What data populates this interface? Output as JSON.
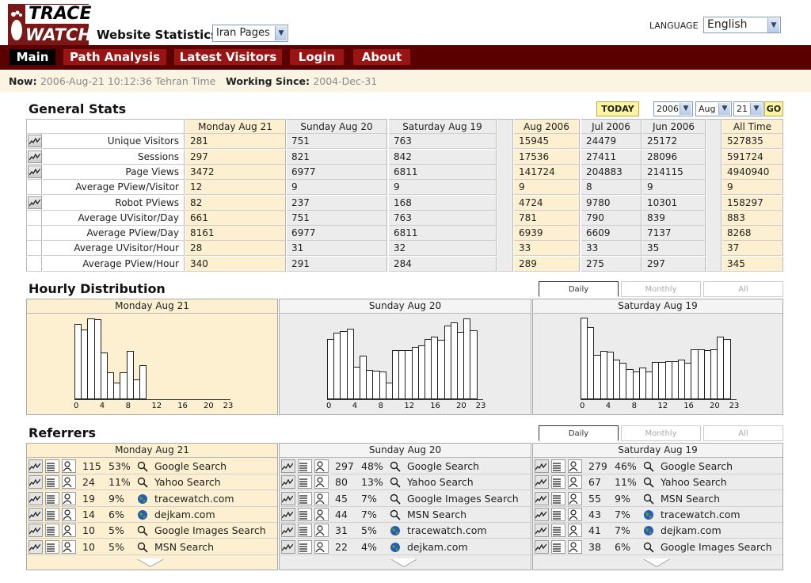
{
  "header": {
    "logo_top": "TRACE",
    "logo_bottom": "WATCH",
    "site_title": "Website Statistics",
    "site_select": "Iran Pages",
    "language_label": "LANGUAGE",
    "language_value": "English"
  },
  "nav": [
    "Main",
    "Path Analysis",
    "Latest Visitors",
    "Login",
    "About"
  ],
  "status": {
    "now_label": "Now:",
    "now_value": "2006-Aug-21 10:12:36 Tehran Time",
    "since_label": "Working Since:",
    "since_value": "2004-Dec-31"
  },
  "general": {
    "title": "General Stats",
    "today_label": "TODAY",
    "year": "2006",
    "month": "Aug",
    "day": "21",
    "go_label": "GO",
    "columns": [
      "Monday Aug 21",
      "Sunday Aug 20",
      "Saturday Aug 19",
      "Aug 2006",
      "Jul 2006",
      "Jun 2006",
      "All Time"
    ],
    "rows": [
      {
        "label": "Unique Visitors",
        "icon": true,
        "values": [
          "281",
          "751",
          "763",
          "15945",
          "24479",
          "25172",
          "527835"
        ]
      },
      {
        "label": "Sessions",
        "icon": true,
        "values": [
          "297",
          "821",
          "842",
          "17536",
          "27411",
          "28096",
          "591724"
        ]
      },
      {
        "label": "Page Views",
        "icon": true,
        "values": [
          "3472",
          "6977",
          "6811",
          "141724",
          "204883",
          "214115",
          "4940940"
        ]
      },
      {
        "label": "Average PView/Visitor",
        "icon": false,
        "values": [
          "12",
          "9",
          "9",
          "9",
          "8",
          "9",
          "9"
        ]
      },
      {
        "label": "Robot PViews",
        "icon": true,
        "values": [
          "82",
          "237",
          "168",
          "4724",
          "9780",
          "10301",
          "158297"
        ]
      },
      {
        "label": "Average UVisitor/Day",
        "icon": false,
        "values": [
          "661",
          "751",
          "763",
          "781",
          "790",
          "839",
          "883"
        ]
      },
      {
        "label": "Average PView/Day",
        "icon": false,
        "values": [
          "8161",
          "6977",
          "6811",
          "6939",
          "6609",
          "7137",
          "8268"
        ]
      },
      {
        "label": "Average UVisitor/Hour",
        "icon": false,
        "values": [
          "28",
          "31",
          "32",
          "33",
          "33",
          "35",
          "37"
        ]
      },
      {
        "label": "Average PView/Hour",
        "icon": false,
        "values": [
          "340",
          "291",
          "284",
          "289",
          "275",
          "297",
          "345"
        ]
      }
    ]
  },
  "hourly": {
    "title": "Hourly Distribution",
    "tabs": [
      "Daily",
      "Monthly",
      "All"
    ],
    "x_ticks": [
      "0",
      "4",
      "8",
      "12",
      "16",
      "20",
      "23"
    ],
    "panels": [
      {
        "day": "Monday Aug 21",
        "values": [
          0.9,
          0.84,
          0.97,
          0.96,
          0.56,
          0.32,
          0.2,
          0.32,
          0.58,
          0.24,
          0.41
        ]
      },
      {
        "day": "Sunday Aug 20",
        "values": [
          0.72,
          0.8,
          0.82,
          0.85,
          0.39,
          0.52,
          0.35,
          0.34,
          0.33,
          0.2,
          0.59,
          0.59,
          0.59,
          0.63,
          0.65,
          0.72,
          0.75,
          0.71,
          0.89,
          0.92,
          0.81,
          0.97,
          0.83
        ]
      },
      {
        "day": "Saturday Aug 19",
        "values": [
          0.98,
          0.87,
          0.53,
          0.58,
          0.57,
          0.48,
          0.44,
          0.36,
          0.33,
          0.38,
          0.33,
          0.45,
          0.45,
          0.46,
          0.46,
          0.48,
          0.44,
          0.6,
          0.6,
          0.59,
          0.6,
          0.75,
          0.72
        ]
      }
    ]
  },
  "referrers": {
    "title": "Referrers",
    "tabs": [
      "Daily",
      "Monthly",
      "All"
    ],
    "panels": [
      {
        "day": "Monday Aug 21",
        "rows": [
          {
            "count": "115",
            "pct": "53%",
            "kind": "search",
            "name": "Google Search"
          },
          {
            "count": "24",
            "pct": "11%",
            "kind": "search",
            "name": "Yahoo Search"
          },
          {
            "count": "19",
            "pct": "9%",
            "kind": "site",
            "name": "tracewatch.com"
          },
          {
            "count": "14",
            "pct": "6%",
            "kind": "site",
            "name": "dejkam.com"
          },
          {
            "count": "10",
            "pct": "5%",
            "kind": "search",
            "name": "Google Images Search"
          },
          {
            "count": "10",
            "pct": "5%",
            "kind": "search",
            "name": "MSN Search"
          }
        ]
      },
      {
        "day": "Sunday Aug 20",
        "rows": [
          {
            "count": "297",
            "pct": "48%",
            "kind": "search",
            "name": "Google Search"
          },
          {
            "count": "80",
            "pct": "13%",
            "kind": "search",
            "name": "Yahoo Search"
          },
          {
            "count": "45",
            "pct": "7%",
            "kind": "search",
            "name": "Google Images Search"
          },
          {
            "count": "44",
            "pct": "7%",
            "kind": "search",
            "name": "MSN Search"
          },
          {
            "count": "31",
            "pct": "5%",
            "kind": "site",
            "name": "tracewatch.com"
          },
          {
            "count": "22",
            "pct": "4%",
            "kind": "site",
            "name": "dejkam.com"
          }
        ]
      },
      {
        "day": "Saturday Aug 19",
        "rows": [
          {
            "count": "279",
            "pct": "46%",
            "kind": "search",
            "name": "Google Search"
          },
          {
            "count": "67",
            "pct": "11%",
            "kind": "search",
            "name": "Yahoo Search"
          },
          {
            "count": "55",
            "pct": "9%",
            "kind": "search",
            "name": "MSN Search"
          },
          {
            "count": "43",
            "pct": "7%",
            "kind": "site",
            "name": "tracewatch.com"
          },
          {
            "count": "41",
            "pct": "7%",
            "kind": "site",
            "name": "dejkam.com"
          },
          {
            "count": "38",
            "pct": "6%",
            "kind": "search",
            "name": "Google Images Search"
          }
        ]
      }
    ]
  },
  "colors": {
    "brand": "#7a1818",
    "nav_bg": "#5a0000",
    "nav_item": "#9b1414",
    "highlight": "#fcf0d0",
    "neutral": "#ececec"
  }
}
